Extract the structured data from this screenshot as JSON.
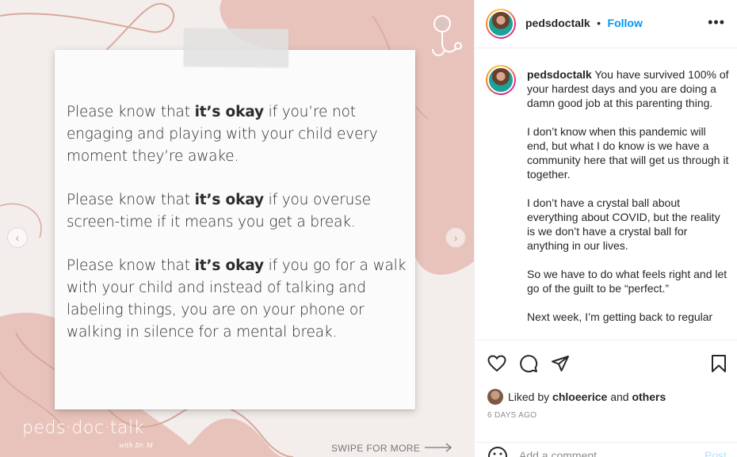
{
  "media": {
    "note_paragraphs": [
      {
        "before": "Please know that ",
        "bold": "it’s okay",
        "after": " if you’re not engaging and playing with your child every moment they’re awake."
      },
      {
        "before": "Please know that ",
        "bold": "it’s okay",
        "after": " if you overuse screen-time if it means you get a break."
      },
      {
        "before": "Please know that ",
        "bold": "it’s okay",
        "after": " if you go for a walk with your child and instead of talking and labeling things, you are on your phone or walking in silence for a mental break."
      }
    ],
    "brand_logo": "peds·doc·talk",
    "brand_sub": "with Dr. M",
    "swipe_label": "SWIPE FOR MORE",
    "prev_icon": "chevron-left-icon",
    "next_icon": "chevron-right-icon",
    "colors": {
      "blob": "#e8c3bb",
      "background": "#f3eeec",
      "line": "#d9a89c"
    }
  },
  "header": {
    "username": "pedsdoctalk",
    "separator": "•",
    "follow_label": "Follow",
    "more_label": "•••"
  },
  "caption": {
    "username": "pedsdoctalk",
    "first": "You have survived 100% of your hardest days and you are doing a damn good job at this parenting thing.",
    "paragraphs": [
      "I don’t know when this pandemic will end, but what I do know is we have a community here that will get us through it together.",
      "I don’t have a crystal ball about everything about COVID, but the reality is we don’t have a crystal ball for anything in our lives.",
      "So we have to do what feels right and let go of the guilt to be “perfect.”",
      "Next week, I’m getting back to regular"
    ]
  },
  "actions": {
    "liked_prefix": "Liked by",
    "liked_user": "chloeerice",
    "liked_and": "and",
    "liked_others": "others",
    "date": "6 DAYS AGO"
  },
  "comment": {
    "placeholder": "Add a comment…",
    "post_label": "Post"
  },
  "colors": {
    "link": "#0095f6",
    "text": "#262626",
    "muted": "#8e8e8e"
  }
}
